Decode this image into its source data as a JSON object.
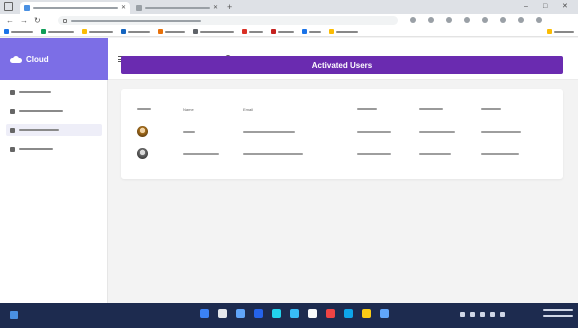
{
  "browser": {
    "tabs": [
      {
        "title": "",
        "favicon_color": "#4a90e2",
        "active": true
      },
      {
        "title": "",
        "favicon_color": "#9aa0a6",
        "active": false
      }
    ],
    "new_tab_glyph": "+",
    "window_controls": [
      "–",
      "□",
      "✕"
    ],
    "url": "",
    "bookmarks": [
      {
        "label": "",
        "icon_color": "#1a73e8"
      },
      {
        "label": "",
        "icon_color": "#0f9d58"
      },
      {
        "label": "",
        "icon_color": "#fbbc04"
      },
      {
        "label": "",
        "icon_color": "#1565c0"
      },
      {
        "label": "",
        "icon_color": "#e8710a"
      },
      {
        "label": "",
        "icon_color": "#5f6368"
      },
      {
        "label": "",
        "icon_color": "#d93025"
      },
      {
        "label": "",
        "icon_color": "#c5221f"
      },
      {
        "label": "",
        "icon_color": "#1a73e8"
      },
      {
        "label": "",
        "icon_color": "#fbbc04"
      }
    ],
    "bookmarks_right": {
      "label": "",
      "icon_color": "#fbbc04"
    }
  },
  "sidebar": {
    "brand": {
      "name": "Cloud",
      "color": "#7c6ee6"
    },
    "items": [
      {
        "label": "",
        "icon": "dashboard-icon",
        "active": false
      },
      {
        "label": "",
        "icon": "users-icon",
        "active": false
      },
      {
        "label": "",
        "icon": "user-check-icon",
        "active": true
      },
      {
        "label": "",
        "icon": "user-x-icon",
        "active": false
      }
    ]
  },
  "topbar": {
    "search_placeholder": ""
  },
  "page": {
    "title": "Activated Users",
    "accent_color": "#6a2bb0"
  },
  "table": {
    "columns": [
      "",
      "Name",
      "Email",
      "",
      "",
      ""
    ],
    "rows": [
      {
        "avatar": "avatar-1",
        "cells": [
          "",
          "",
          "",
          "",
          ""
        ]
      },
      {
        "avatar": "avatar-2",
        "cells": [
          "",
          "",
          "",
          "",
          ""
        ]
      }
    ]
  },
  "taskbar": {
    "pinned_icon_colors": [
      "#3b82f6",
      "#e5e7eb",
      "#60a5fa",
      "#2563eb",
      "#22d3ee",
      "#38bdf8",
      "#f8fafc",
      "#ef4444",
      "#0ea5e9",
      "#facc15",
      "#60a5fa"
    ],
    "time": "",
    "date": ""
  }
}
